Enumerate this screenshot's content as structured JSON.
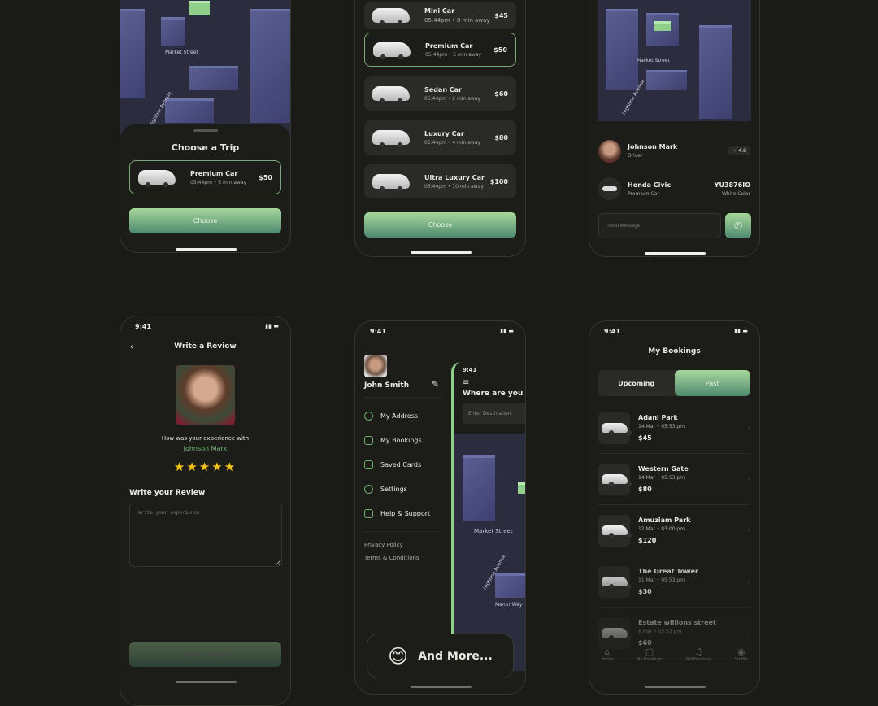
{
  "screen1": {
    "map_labels": [
      "Market Street",
      "Highline Avenue"
    ],
    "title": "Choose a Trip",
    "trip": {
      "name": "Premium Car",
      "sub": "05:44pm • 5 min away",
      "price": "$50"
    },
    "button": "Choose"
  },
  "screen2": {
    "cars": [
      {
        "name": "Mini Car",
        "sub": "05:44pm • 8 min away",
        "price": "$45"
      },
      {
        "name": "Premium Car",
        "sub": "05:44pm • 5 min away",
        "price": "$50"
      },
      {
        "name": "Sedan Car",
        "sub": "05:44pm • 2 min away",
        "price": "$60"
      },
      {
        "name": "Luxury Car",
        "sub": "05:44pm • 4 min away",
        "price": "$80"
      },
      {
        "name": "Ultra Luxury Car",
        "sub": "05:44pm • 10 min away",
        "price": "$100"
      }
    ],
    "selected": "Premium Car",
    "button": "Choose"
  },
  "screen3": {
    "map_labels": [
      "Market Street",
      "Highline Avenue"
    ],
    "driver": {
      "name": "Johnson Mark",
      "role": "Driver",
      "rating": "4.8"
    },
    "vehicle": {
      "model": "Honda Civic",
      "type": "Premium Car",
      "plate": "YU3876IO",
      "color": "White Color"
    },
    "message_placeholder": "Send Message"
  },
  "screen4": {
    "time": "9:41",
    "title": "Write a Review",
    "prompt": "How was your experience with",
    "driver": "Johnson Mark",
    "rating": 5,
    "stars": "★★★★★",
    "section": "Write your Review",
    "placeholder": "Write your experience",
    "button": "Submit Review"
  },
  "screen5": {
    "time": "9:41",
    "user": "John Smith",
    "menu": [
      "My Address",
      "My Bookings",
      "Saved Cards",
      "Settings",
      "Help & Support"
    ],
    "links": [
      "Privacy Policy",
      "Terms & Conditions"
    ],
    "inner": {
      "time": "9:41",
      "title": "Where are you",
      "placeholder": "Enter Destination",
      "map_labels": [
        "Market Street",
        "Highline Avenue",
        "Manor Way"
      ]
    },
    "badge": "And More...",
    "emoji": "😊"
  },
  "screen6": {
    "time": "9:41",
    "title": "My Bookings",
    "tabs": [
      "Upcoming",
      "Past"
    ],
    "active_tab": "Past",
    "bookings": [
      {
        "place": "Adani Park",
        "when": "14 Mar • 05:53 pm",
        "price": "$45"
      },
      {
        "place": "Western Gate",
        "when": "14 Mar • 05:53 pm",
        "price": "$80"
      },
      {
        "place": "Amuziam Park",
        "when": "12 Mar • 03:00 pm",
        "price": "$120"
      },
      {
        "place": "The Great Tower",
        "when": "11 Mar • 05:53 pm",
        "price": "$30"
      },
      {
        "place": "Estate willions street",
        "when": "8 Mar • 05:53 pm",
        "price": "$60"
      }
    ],
    "nav": [
      "Home",
      "My Bookings",
      "Notifications",
      "Profile"
    ]
  },
  "colors": {
    "accent": "#8fcf8a",
    "background": "#1a1b16",
    "card": "#2a2b26",
    "map": "#3e4170",
    "star": "#f5c518"
  }
}
